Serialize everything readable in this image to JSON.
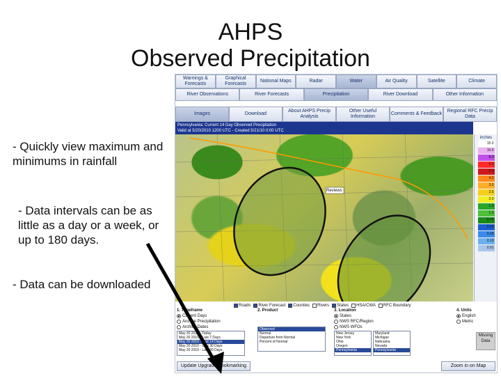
{
  "slide": {
    "title_line1": "AHPS",
    "title_line2": "Observed Precipitation",
    "bullets": [
      "- Quickly view maximum and minimums in rainfall",
      "- Data intervals can be as little as a day or a week, or up to 180 days.",
      "- Data can be downloaded"
    ]
  },
  "screenshot": {
    "nav1": [
      "Warnings & Forecasts",
      "Graphical Forecasts",
      "National Maps",
      "Radar",
      "Water",
      "Air Quality",
      "Satellite",
      "Climate"
    ],
    "nav1_active": 4,
    "nav2": [
      "River Observations",
      "River Forecasts",
      "Precipitation",
      "River Download",
      "Other Information"
    ],
    "nav2_active": 2,
    "nav3": [
      "Images",
      "Download",
      "About AHPS Precip Analysis",
      "Other Useful Information",
      "Comments & Feedback",
      "Regional RFC Precip Data"
    ],
    "nav3_active": 0,
    "map_title": "Pennsylvania: Current 14 Day Observed Precipitation",
    "map_valid": "Valid at 5/20/2010 1200 UTC - Created 5/21/10 0:00 UTC",
    "map_popup": "Reviews",
    "legend_unit": "inches",
    "legend": [
      {
        "label": "15.0",
        "color": "#ffffff"
      },
      {
        "label": "10.0",
        "color": "#e9b0f2"
      },
      {
        "label": "8.0",
        "color": "#c050e8"
      },
      {
        "label": "6.0",
        "color": "#ff2a2a"
      },
      {
        "label": "5.0",
        "color": "#d11a1a"
      },
      {
        "label": "4.0",
        "color": "#ff8a1a"
      },
      {
        "label": "3.0",
        "color": "#ffae2a"
      },
      {
        "label": "2.5",
        "color": "#f5d01a"
      },
      {
        "label": "2.0",
        "color": "#f2ef1f"
      },
      {
        "label": "1.5",
        "color": "#2aa62a"
      },
      {
        "label": "1.0",
        "color": "#4dbf3a"
      },
      {
        "label": "0.75",
        "color": "#1a8a1a"
      },
      {
        "label": "0.50",
        "color": "#1a5fd1"
      },
      {
        "label": "0.25",
        "color": "#3a8ae8"
      },
      {
        "label": "0.10",
        "color": "#6ab0ef"
      },
      {
        "label": "0.01",
        "color": "#a8c6ea"
      }
    ],
    "layers": [
      "Roads",
      "River Forecast",
      "Counties",
      "Rivers",
      "States",
      "HSA/CWA",
      "RFC Boundary"
    ],
    "layers_checked": [
      true,
      true,
      true,
      false,
      true,
      false,
      false
    ],
    "panel1": {
      "title": "1. Timeframe",
      "options": [
        "Current Days",
        "Archive Precipitation",
        "Archive Dates"
      ],
      "selected": 0,
      "list": [
        "May 20 2010 - Today",
        "May 20 2010 - Last 7 Days",
        "May 20 2010 - Last 14 Days",
        "May 20 2010 - Last 30 Days",
        "May 20 2010 - Last 60 Days"
      ],
      "list_selected": 2
    },
    "panel2": {
      "title": "2. Product",
      "list": [
        "Observed",
        "Normal",
        "Departure from Normal",
        "Percent of Normal"
      ],
      "list_selected": 0
    },
    "panel3": {
      "title": "3. Location",
      "options": [
        "States",
        "NWS RFC/Region",
        "NWS WFOs"
      ],
      "selected": 0,
      "list_a": [
        "New Jersey",
        "New York",
        "Ohio",
        "Oregon",
        "Pennsylvania"
      ],
      "list_a_selected": 4,
      "list_b": [
        "Maryland",
        "Michigan",
        "Nebraska",
        "Nevada",
        "Pennsylvania"
      ],
      "list_b_selected": 4
    },
    "panel4": {
      "title": "4. Units",
      "options": [
        "English",
        "Metric"
      ],
      "selected": 0
    },
    "missing_data": "Missing Data",
    "btn_update": "Update Upgrade/Bookmarking",
    "btn_zoom": "Zoom in on Map"
  }
}
